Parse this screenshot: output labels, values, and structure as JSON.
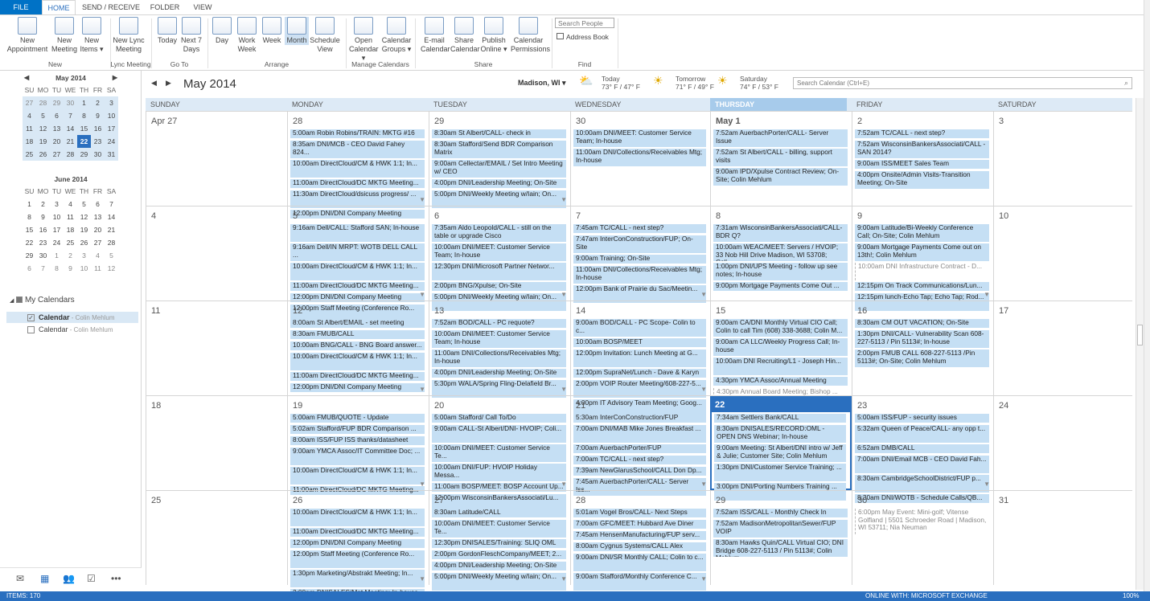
{
  "tabs": {
    "file": "FILE",
    "home": "HOME",
    "send": "SEND / RECEIVE",
    "folder": "FOLDER",
    "view": "VIEW"
  },
  "ribbon": {
    "buttons": [
      {
        "label": "New\nAppointment",
        "icon": "calendar-icon"
      },
      {
        "label": "New\nMeeting",
        "icon": "meeting-icon"
      },
      {
        "label": "New\nItems ▾",
        "icon": "new-items-icon"
      },
      {
        "label": "New Lync\nMeeting",
        "icon": "lync-icon"
      },
      {
        "label": "Today",
        "icon": "today-icon"
      },
      {
        "label": "Next 7\nDays",
        "icon": "next7-icon"
      },
      {
        "label": "Day",
        "icon": "day-icon"
      },
      {
        "label": "Work\nWeek",
        "icon": "workweek-icon"
      },
      {
        "label": "Week",
        "icon": "week-icon"
      },
      {
        "label": "Month",
        "icon": "month-icon"
      },
      {
        "label": "Schedule\nView",
        "icon": "schedule-icon"
      },
      {
        "label": "Open\nCalendar ▾",
        "icon": "open-calendar-icon"
      },
      {
        "label": "Calendar\nGroups ▾",
        "icon": "calendar-groups-icon"
      },
      {
        "label": "E-mail\nCalendar",
        "icon": "email-calendar-icon"
      },
      {
        "label": "Share\nCalendar",
        "icon": "share-calendar-icon"
      },
      {
        "label": "Publish\nOnline ▾",
        "icon": "publish-icon"
      },
      {
        "label": "Calendar\nPermissions",
        "icon": "permissions-icon"
      }
    ],
    "groups": [
      "New",
      "Lync Meeting",
      "Go To",
      "Arrange",
      "Manage Calendars",
      "Share",
      "Find"
    ],
    "search_people": "Search People",
    "address_book": "Address Book"
  },
  "nav": {
    "title": "May 2014",
    "location": "Madison, WI ▾",
    "weather": [
      {
        "day": "Today",
        "temp": "73° F / 47° F"
      },
      {
        "day": "Tomorrow",
        "temp": "71° F / 49° F"
      },
      {
        "day": "Saturday",
        "temp": "74° F / 53° F"
      }
    ],
    "search_placeholder": "Search Calendar (Ctrl+E)"
  },
  "weekdays": [
    "SUNDAY",
    "MONDAY",
    "TUESDAY",
    "WEDNESDAY",
    "THURSDAY",
    "FRIDAY",
    "SATURDAY"
  ],
  "mini_may": {
    "title": "May 2014",
    "head": [
      "SU",
      "MO",
      "TU",
      "WE",
      "TH",
      "FR",
      "SA"
    ],
    "days": [
      "27",
      "28",
      "29",
      "30",
      "1",
      "2",
      "3",
      "4",
      "5",
      "6",
      "7",
      "8",
      "9",
      "10",
      "11",
      "12",
      "13",
      "14",
      "15",
      "16",
      "17",
      "18",
      "19",
      "20",
      "21",
      "22",
      "23",
      "24",
      "25",
      "26",
      "27",
      "28",
      "29",
      "30",
      "31"
    ]
  },
  "mini_june": {
    "title": "June 2014",
    "head": [
      "SU",
      "MO",
      "TU",
      "WE",
      "TH",
      "FR",
      "SA"
    ],
    "days": [
      "1",
      "2",
      "3",
      "4",
      "5",
      "6",
      "7",
      "8",
      "9",
      "10",
      "11",
      "12",
      "13",
      "14",
      "15",
      "16",
      "17",
      "18",
      "19",
      "20",
      "21",
      "22",
      "23",
      "24",
      "25",
      "26",
      "27",
      "28",
      "29",
      "30",
      "1",
      "2",
      "3",
      "4",
      "5",
      "6",
      "7",
      "8",
      "9",
      "10",
      "11",
      "12"
    ]
  },
  "my_calendars": {
    "title": "My Calendars",
    "items": [
      {
        "name": "Calendar",
        "owner": " - Colin Mehlum",
        "checked": true
      },
      {
        "name": "Calendar",
        "owner": " - Colin Mehlum",
        "checked": false
      }
    ]
  },
  "status": {
    "items": "ITEMS: 170",
    "connection": "ONLINE WITH: MICROSOFT EXCHANGE",
    "zoom": "100%"
  },
  "weeks": [
    [
      {
        "d": "Apr 27",
        "a": []
      },
      {
        "d": "28",
        "a": [
          "5:00am Robin Robins/TRAIN: MKTG #16",
          "8:35am DNI/MCB - CEO David Fahey 824...",
          "10:00am DirectCloud/CM & HWK 1:1; In...",
          "11:00am DirectCloud/DC MKTG Meeting...",
          "11:30am DirectCloud/dsicuss progress/ ...",
          "12:00pm DNI/DNI Company Meeting"
        ]
      },
      {
        "d": "29",
        "a": [
          "8:30am St Albert/CALL- check in",
          "8:30am Stafford/Send BDR Comparison Matrix",
          "9:00am Cellectar/EMAIL / Set Intro Meeting w/ CEO",
          "4:00pm DNI/Leadership Meeting; On-Site",
          "5:00pm DNI/Weekly Meeting w/Iain; On..."
        ]
      },
      {
        "d": "30",
        "a": [
          "10:00am DNI/MEET: Customer Service Team; In-house",
          "11:00am DNI/Collections/Receivables Mtg; In-house"
        ]
      },
      {
        "d": "May 1",
        "a": [
          "7:52am AuerbachPorter/CALL- Server Issue",
          "7:52am St Albert/CALL - billing, support visits",
          "9:00am IPD/Xpulse Contract Review; On-Site; Colin Mehlum"
        ]
      },
      {
        "d": "2",
        "a": [
          "7:52am TC/CALL - next step?",
          "7:52am WisconsinBankersAssociati/CALL - SAN 2014?",
          "9:00am ISS/MEET Sales Team",
          "4:00pm Onsite/Admin Visits-Transition Meeting; On-Site"
        ]
      },
      {
        "d": "3",
        "a": []
      }
    ],
    [
      {
        "d": "4",
        "a": []
      },
      {
        "d": "5",
        "a": [
          "9:16am Dell/CALL: Stafford SAN; In-house",
          "9:16am Dell/IN MRPT: WOTB DELL CALL ...",
          "10:00am DirectCloud/CM & HWK 1:1; In...",
          "11:00am DirectCloud/DC MKTG Meeting...",
          "12:00pm DNI/DNI Company Meeting",
          "12:00pm Staff Meeting (Conference Ro..."
        ]
      },
      {
        "d": "6",
        "a": [
          "7:35am Aldo Leopold/CALL - still on the table or upgrade Cisco",
          "10:00am DNI/MEET: Customer Service Team; In-house",
          "12:30pm DNI/Microsoft Partner Networ...",
          "2:00pm BNG/Xpulse; On-Site",
          "5:00pm DNI/Weekly Meeting w/Iain; On..."
        ]
      },
      {
        "d": "7",
        "a": [
          "7:45am TC/CALL - next step?",
          "7:47am InterConConstruction/FUP; On-Site",
          "9:00am Training; On-Site",
          "11:00am DNI/Collections/Receivables Mtg; In-house",
          "12:00pm Bank of Prairie du Sac/Meetin..."
        ]
      },
      {
        "d": "8",
        "a": [
          "7:31am WisconsinBankersAssociati/CALL-BDR Q?",
          "10:00am WEAC/MEET: Servers / HVOIP; 33 Nob Hill Drive Madison, WI 53708; Coli...",
          "1:00pm DNI/UPS Meeting - follow up see notes; In-house",
          "9:00pm Mortgage Payments Come Out ..."
        ]
      },
      {
        "d": "9",
        "a": [
          "9:00am Latitude/Bi-Weekly Conference Call; On-Site; Colin Mehlum",
          "9:00am Mortgage Payments Come out on 13th!; Colin Mehlum",
          "10:00am DNI Infrastructure Contract - D...",
          "12:15pm On Track Communications/Lun...",
          "12:15pm lunch-Echo Tap; Echo Tap; Rod..."
        ]
      },
      {
        "d": "10",
        "a": []
      }
    ],
    [
      {
        "d": "11",
        "a": []
      },
      {
        "d": "12",
        "a": [
          "8:00am St Albert/EMAIL - set meeting",
          "8:30am FMUB/CALL",
          "10:00am BNG/CALL - BNG Board answer...",
          "10:00am DirectCloud/CM & HWK 1:1; In...",
          "11:00am DirectCloud/DC MKTG Meeting...",
          "12:00pm DNI/DNI Company Meeting"
        ]
      },
      {
        "d": "13",
        "a": [
          "7:52am BOD/CALL - PC requote?",
          "10:00am DNI/MEET: Customer Service Team; In-house",
          "11:00am DNI/Collections/Receivables Mtg; In-house",
          "4:00pm DNI/Leadership Meeting; On-Site",
          "5:30pm WALA/Spring Fling-Delafield Br..."
        ]
      },
      {
        "d": "14",
        "a": [
          "9:00am BOD/CALL - PC Scope- Colin to c...",
          "10:00am BOSP/MEET",
          "12:00pm Invitation: Lunch Meeting at G...",
          "12:00pm SupraNet/Lunch - Dave & Karyn",
          "2:00pm VOIP Router Meeting/608-227-5...",
          "4:00pm IT Advisory Team Meeting; Goog..."
        ]
      },
      {
        "d": "15",
        "a": [
          "9:00am CA/DNI Monthly Virtual CIO Call; Colin to call Tim (608) 338-3688; Colin M...",
          "9:00am CA LLC/Weekly Progress Call; In-house",
          "10:00am DNI Recruiting/L1 - Joseph Hin...",
          "4:30pm YMCA Assoc/Annual Meeting",
          "4:30pm Annual Board Meeting; Bishop ..."
        ]
      },
      {
        "d": "16",
        "a": [
          "8:30am CM OUT VACATION; On-Site",
          "1:30pm DNI/CALL- Vulnerability Scan 608-227-5113 / Pin 5113#; In-house",
          "2:00pm FMUB CALL 608-227-5113 /Pin 5113#; On-Site; Colin Mehlum"
        ]
      },
      {
        "d": "17",
        "a": []
      }
    ],
    [
      {
        "d": "18",
        "a": []
      },
      {
        "d": "19",
        "a": [
          "5:00am FMUB/QUOTE - Update",
          "5:02am Stafford/FUP BDR Comparison ...",
          "8:00am ISS/FUP ISS thanks/datasheet",
          "9:00am YMCA Assoc/IT Committee Doc; ...",
          "10:00am DirectCloud/CM & HWK 1:1; In...",
          "11:00am DirectCloud/DC MKTG Meeting..."
        ]
      },
      {
        "d": "20",
        "a": [
          "5:00am Stafford/ Call To/Do",
          "9:00am CALL-St Albert/DNI- HVOIP; Coli...",
          "10:00am DNI/MEET: Customer Service Te...",
          "10:00am DNI/FUP: HVOIP Holiday Messa...",
          "11:00am BOSP/MEET: BOSP Account Up...",
          "12:00pm WisconsinBankersAssociati/Lu..."
        ]
      },
      {
        "d": "21",
        "a": [
          "5:30am InterConConstruction/FUP",
          "7:00am DNI/MAB Mike Jones Breakfast ...",
          "7:00am AuerbachPorter/FUP",
          "7:00am TC/CALL - next step?",
          "7:39am NewGlarusSchool/CALL Don Dp...",
          "7:45am AuerbachPorter/CALL- Server Iss..."
        ]
      },
      {
        "d": "22",
        "a": [
          "7:34am Settlers Bank/CALL",
          "8:30am DNISALES/RECORD:OML - OPEN DNS Webinar; In-house",
          "9:00am Meeting: St Albert/DNI intro w/ Jeff & Julie; Customer Site; Colin Mehlum",
          "1:30pm DNI/Customer Service Training; ...",
          "3:00pm DNI/Porting Numbers Training ..."
        ]
      },
      {
        "d": "23",
        "a": [
          "5:00am ISS/FUP - security issues",
          "5:32am Queen of Peace/CALL- any opp t...",
          "6:52am DMB/CALL",
          "7:00am DNI/Email MCB - CEO David Fah...",
          "8:30am CambridgeSchoolDistrict/FUP p...",
          "8:30am DNI/WOTB - Schedule Calls/QB..."
        ]
      },
      {
        "d": "24",
        "a": []
      }
    ],
    [
      {
        "d": "25",
        "a": []
      },
      {
        "d": "26",
        "a": [
          "10:00am DirectCloud/CM & HWK 1:1; In...",
          "11:00am DirectCloud/DC MKTG Meeting...",
          "12:00pm DNI/DNI Company Meeting",
          "12:00pm Staff Meeting (Conference Ro...",
          "1:30pm Marketing/Abstrakt Meeting; In...",
          "2:00pm DNISALES/Mgt Meeting; In-house"
        ]
      },
      {
        "d": "27",
        "a": [
          "8:30am Latitude/CALL",
          "10:00am DNI/MEET: Customer Service Te...",
          "12:30pm DNISALES/Training: SLIQ OML",
          "2:00pm GordonFleschCompany/MEET; 2...",
          "4:00pm DNI/Leadership Meeting; On-Site",
          "5:00pm DNI/Weekly Meeting w/Iain; On..."
        ]
      },
      {
        "d": "28",
        "a": [
          "5:01am Vogel Bros/CALL- Next Steps",
          "7:00am GFC/MEET: Hubbard Ave Diner",
          "7:45am HensenManufacturing/FUP serv...",
          "8:00am Cygnus Systems/CALL Alex",
          "9:00am DNI/SR Monthly CALL; Colin to c...",
          "9:00am Stafford/Monthly Conference C..."
        ]
      },
      {
        "d": "29",
        "a": [
          "7:52am ISS/CALL - Monthly Check In",
          "7:52am MadisonMetropolitanSewer/FUP VOIP",
          "8:30am Hawks Quin/CALL Virtual CIO; DNI Bridge 608-227-5113 / Pin 5113#; Colin Mehlum"
        ]
      },
      {
        "d": "30",
        "a": [
          "6:00pm May Event: Mini-golf; Vitense Golfland | 5501 Schroeder Road | Madison, WI 53711; Nia Neuman"
        ]
      },
      {
        "d": "31",
        "a": []
      }
    ]
  ]
}
